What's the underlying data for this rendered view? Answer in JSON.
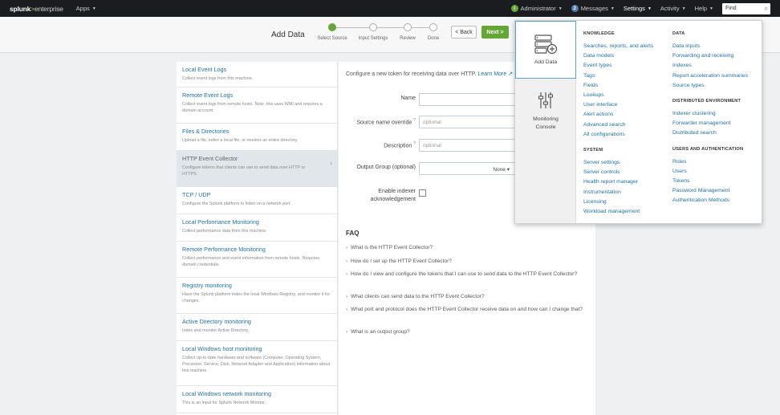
{
  "topbar": {
    "logo_brand": "splunk",
    "logo_gt": ">",
    "logo_product": "enterprise",
    "apps": "Apps",
    "admin_badge": "i",
    "admin": "Administrator",
    "messages_badge": "2",
    "messages": "Messages",
    "settings": "Settings",
    "activity": "Activity",
    "help": "Help",
    "find_placeholder": "Find"
  },
  "wizard": {
    "title": "Add Data",
    "steps": [
      "Select Source",
      "Input Settings",
      "Review",
      "Done"
    ],
    "back_label": "< Back",
    "next_label": "Next >"
  },
  "sources": [
    {
      "title": "Local Event Logs",
      "desc": "Collect event logs from this machine."
    },
    {
      "title": "Remote Event Logs",
      "desc": "Collect event logs from remote hosts. Note: this uses WMI and requires a domain account."
    },
    {
      "title": "Files & Directories",
      "desc": "Upload a file, index a local file, or monitor an entire directory."
    },
    {
      "title": "HTTP Event Collector",
      "desc": "Configure tokens that clients can use to send data over HTTP or HTTPS."
    },
    {
      "title": "TCP / UDP",
      "desc": "Configure the Splunk platform to listen on a network port."
    },
    {
      "title": "Local Performance Monitoring",
      "desc": "Collect performance data from this machine."
    },
    {
      "title": "Remote Performance Monitoring",
      "desc": "Collect performance and event information from remote hosts. Requires domain credentials."
    },
    {
      "title": "Registry monitoring",
      "desc": "Have the Splunk platform index the local Windows Registry, and monitor it for changes."
    },
    {
      "title": "Active Directory monitoring",
      "desc": "Index and monitor Active Directory."
    },
    {
      "title": "Local Windows host monitoring",
      "desc": "Collect up-to-date hardware and software (Computer, Operating System, Processor, Service, Disk, Network Adapter and Application) information about this machine."
    },
    {
      "title": "Local Windows network monitoring",
      "desc": "This is an input for Splunk Network Monitor."
    }
  ],
  "form": {
    "intro": "Configure a new token for receiving data over HTTP.",
    "learn_more": "Learn More",
    "name_label": "Name",
    "source_override_label": "Source name override",
    "source_override_placeholder": "optional",
    "description_label": "Description",
    "description_placeholder": "optional",
    "output_group_label": "Output Group (optional)",
    "output_group_value": "None",
    "indexer_ack_label_1": "Enable indexer",
    "indexer_ack_label_2": "acknowledgement"
  },
  "faq": {
    "title": "FAQ",
    "items": [
      "What is the HTTP Event Collector?",
      "How do I set up the HTTP Event Collector?",
      "How do I view and configure the tokens that I can use to send data to the HTTP Event Collector?",
      "What clients can send data to the HTTP Event Collector?",
      "What port and protocol does the HTTP Event Collector receive data on and how can I change that?",
      "What is an output group?"
    ]
  },
  "settings_menu": {
    "tiles": [
      "Add Data",
      "Monitoring Console"
    ],
    "knowledge_title": "KNOWLEDGE",
    "knowledge": [
      "Searches, reports, and alerts",
      "Data models",
      "Event types",
      "Tags",
      "Fields",
      "Lookups",
      "User interface",
      "Alert actions",
      "Advanced search",
      "All configurations"
    ],
    "system_title": "SYSTEM",
    "system": [
      "Server settings",
      "Server controls",
      "Health report manager",
      "Instrumentation",
      "Licensing",
      "Workload management"
    ],
    "data_title": "DATA",
    "data": [
      "Data inputs",
      "Forwarding and receiving",
      "Indexes",
      "Report acceleration summaries",
      "Source types"
    ],
    "distributed_title": "DISTRIBUTED ENVIRONMENT",
    "distributed": [
      "Indexer clustering",
      "Forwarder management",
      "Distributed search"
    ],
    "users_title": "USERS AND AUTHENTICATION",
    "users": [
      "Roles",
      "Users",
      "Tokens",
      "Password Management",
      "Authentication Methods"
    ]
  }
}
